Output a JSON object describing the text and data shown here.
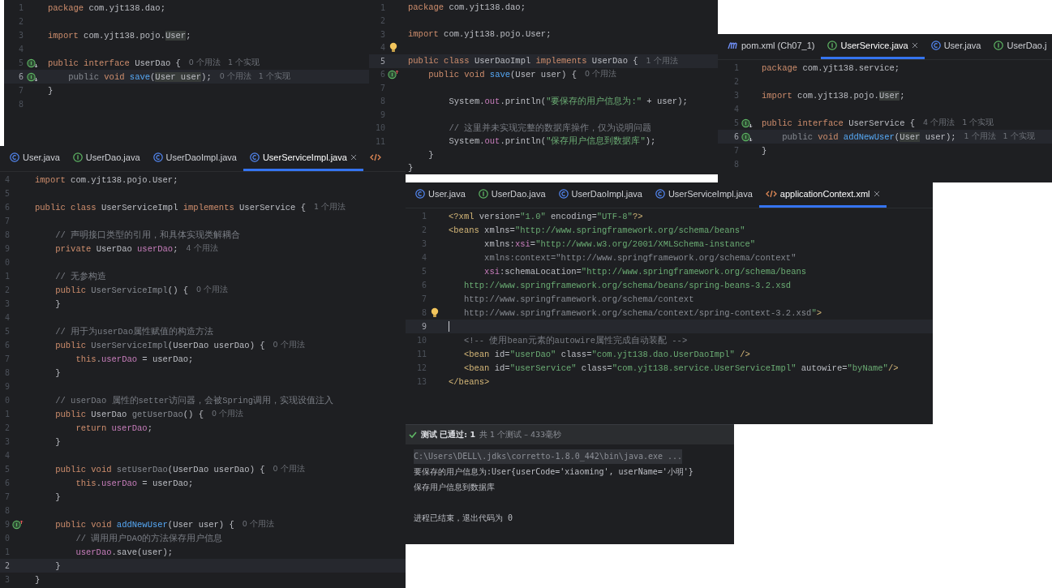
{
  "editors": [
    {
      "lines": [
        {
          "number": "1",
          "tokens": [
            {
              "kind": "kw",
              "text": "package "
            },
            {
              "kind": "plain",
              "text": "com.yjt138.dao;"
            }
          ]
        },
        {
          "number": "2"
        },
        {
          "number": "3",
          "tokens": [
            {
              "kind": "kw",
              "text": "import "
            },
            {
              "kind": "plain",
              "text": "com.yjt138.pojo."
            },
            {
              "kind": "hl",
              "text": "User"
            },
            {
              "kind": "plain",
              "text": ";"
            }
          ]
        },
        {
          "number": "4"
        },
        {
          "number": "5",
          "gutter": {
            "kind": "down"
          },
          "tokens": [
            {
              "kind": "kw",
              "text": "public interface "
            },
            {
              "kind": "plain",
              "text": "UserDao {"
            }
          ],
          "hint": "0 个用法   1 个实现"
        },
        {
          "number": "6",
          "gutter": {
            "kind": "down"
          },
          "current": true,
          "tokens": [
            {
              "kind": "dim",
              "text": "    public "
            },
            {
              "kind": "kw",
              "text": "void "
            },
            {
              "kind": "fn",
              "text": "save"
            },
            {
              "kind": "plain",
              "text": "("
            },
            {
              "kind": "hl",
              "text": "User user"
            },
            {
              "kind": "plain",
              "text": ");"
            }
          ],
          "hint": "0 个用法   1 个实现"
        },
        {
          "number": "7",
          "tokens": [
            {
              "kind": "plain",
              "text": "}"
            }
          ]
        },
        {
          "number": "8"
        }
      ]
    },
    {
      "lines": [
        {
          "number": "1",
          "tokens": [
            {
              "kind": "kw",
              "text": "package "
            },
            {
              "kind": "plain",
              "text": "com.yjt138.dao;"
            }
          ]
        },
        {
          "number": "2"
        },
        {
          "number": "3",
          "tokens": [
            {
              "kind": "kw",
              "text": "import "
            },
            {
              "kind": "plain",
              "text": "com.yjt138.pojo.User;"
            }
          ]
        },
        {
          "number": "4",
          "gutter": {
            "kind": "bulb"
          }
        },
        {
          "number": "5",
          "current": true,
          "tokens": [
            {
              "kind": "kw",
              "text": "public class "
            },
            {
              "kind": "plain",
              "text": "UserDaoImpl "
            },
            {
              "kind": "kw",
              "text": "implements "
            },
            {
              "kind": "plain",
              "text": "UserDao {"
            }
          ],
          "hint": "1 个用法"
        },
        {
          "number": "6",
          "gutter": {
            "kind": "up"
          },
          "tokens": [
            {
              "kind": "kw",
              "text": "    public void "
            },
            {
              "kind": "fn",
              "text": "save"
            },
            {
              "kind": "plain",
              "text": "(User user) {"
            }
          ],
          "hint": "0 个用法"
        },
        {
          "number": "7"
        },
        {
          "number": "8",
          "tokens": [
            {
              "kind": "plain",
              "text": "        System."
            },
            {
              "kind": "field",
              "text": "out"
            },
            {
              "kind": "plain",
              "text": ".println("
            },
            {
              "kind": "str",
              "text": "\"要保存的用户信息为:\""
            },
            {
              "kind": "plain",
              "text": " + user);"
            }
          ]
        },
        {
          "number": "9"
        },
        {
          "number": "10",
          "tokens": [
            {
              "kind": "cmt",
              "text": "        // 这里并未实现完整的数据库操作，仅为说明问题"
            }
          ]
        },
        {
          "number": "11",
          "tokens": [
            {
              "kind": "plain",
              "text": "        System."
            },
            {
              "kind": "field",
              "text": "out"
            },
            {
              "kind": "plain",
              "text": ".println("
            },
            {
              "kind": "str",
              "text": "\"保存用户信息到数据库\""
            },
            {
              "kind": "plain",
              "text": ");"
            }
          ]
        },
        {
          "tokens": [
            {
              "kind": "plain",
              "text": "    }"
            }
          ]
        },
        {
          "tokens": [
            {
              "kind": "plain",
              "text": "}"
            }
          ]
        }
      ]
    },
    {
      "tabs": [
        {
          "label": "pom.xml (Ch07_1)",
          "kind": "maven",
          "selected": false
        },
        {
          "label": "UserService.java",
          "kind": "interface",
          "selected": true
        },
        {
          "label": "User.java",
          "kind": "class",
          "selected": false
        },
        {
          "label": "UserDao.j",
          "kind": "interface",
          "selected": false
        }
      ],
      "lines": [
        {
          "number": "1",
          "tokens": [
            {
              "kind": "kw",
              "text": "package "
            },
            {
              "kind": "plain",
              "text": "com.yjt138.service;"
            }
          ]
        },
        {
          "number": "2"
        },
        {
          "number": "3",
          "tokens": [
            {
              "kind": "kw",
              "text": "import "
            },
            {
              "kind": "plain",
              "text": "com.yjt138.pojo."
            },
            {
              "kind": "hl",
              "text": "User"
            },
            {
              "kind": "plain",
              "text": ";"
            }
          ]
        },
        {
          "number": "4"
        },
        {
          "number": "5",
          "gutter": {
            "kind": "down"
          },
          "tokens": [
            {
              "kind": "kw",
              "text": "public interface "
            },
            {
              "kind": "plain",
              "text": "UserService {"
            }
          ],
          "hint": "4 个用法   1 个实现"
        },
        {
          "number": "6",
          "gutter": {
            "kind": "down"
          },
          "current": true,
          "tokens": [
            {
              "kind": "dim",
              "text": "    public "
            },
            {
              "kind": "kw",
              "text": "void "
            },
            {
              "kind": "fn",
              "text": "addNewUser"
            },
            {
              "kind": "plain",
              "text": "("
            },
            {
              "kind": "hl",
              "text": "User"
            },
            {
              "kind": "plain",
              "text": " user);"
            }
          ],
          "hint": "1 个用法   1 个实现"
        },
        {
          "number": "7",
          "tokens": [
            {
              "kind": "plain",
              "text": "}"
            }
          ]
        },
        {
          "number": "8"
        }
      ]
    },
    {
      "tabs": [
        {
          "label": "User.java",
          "kind": "class",
          "selected": false
        },
        {
          "label": "UserDao.java",
          "kind": "interface",
          "selected": false
        },
        {
          "label": "UserDaoImpl.java",
          "kind": "class",
          "selected": false
        },
        {
          "label": "UserServiceImpl.java",
          "kind": "class",
          "selected": true
        },
        {
          "kind": "xml",
          "selected": false
        }
      ],
      "lines": [
        {
          "number": "4",
          "tokens": [
            {
              "kind": "kw",
              "text": "import "
            },
            {
              "kind": "plain",
              "text": "com.yjt138.pojo.User;"
            }
          ]
        },
        {
          "number": "5"
        },
        {
          "number": "6",
          "tokens": [
            {
              "kind": "kw",
              "text": "public class "
            },
            {
              "kind": "plain",
              "text": "UserServiceImpl "
            },
            {
              "kind": "kw",
              "text": "implements "
            },
            {
              "kind": "plain",
              "text": "UserService {"
            }
          ],
          "hint": "1 个用法"
        },
        {
          "number": "7"
        },
        {
          "number": "8",
          "tokens": [
            {
              "kind": "cmt",
              "text": "    // 声明接口类型的引用，和具体实现类解耦合"
            }
          ]
        },
        {
          "number": "9",
          "tokens": [
            {
              "kind": "kw",
              "text": "    private "
            },
            {
              "kind": "plain",
              "text": "UserDao "
            },
            {
              "kind": "field",
              "text": "userDao"
            },
            {
              "kind": "plain",
              "text": ";"
            }
          ],
          "hint": "4 个用法"
        },
        {
          "number": "0"
        },
        {
          "number": "1",
          "tokens": [
            {
              "kind": "cmt",
              "text": "    // 无参构造"
            }
          ]
        },
        {
          "number": "2",
          "tokens": [
            {
              "kind": "kw",
              "text": "    public "
            },
            {
              "kind": "dim",
              "text": "UserServiceImpl"
            },
            {
              "kind": "plain",
              "text": "() {"
            }
          ],
          "hint": "0 个用法"
        },
        {
          "number": "3",
          "tokens": [
            {
              "kind": "plain",
              "text": "    }"
            }
          ]
        },
        {
          "number": "4"
        },
        {
          "number": "5",
          "tokens": [
            {
              "kind": "cmt",
              "text": "    // 用于为userDao属性赋值的构造方法"
            }
          ]
        },
        {
          "number": "6",
          "tokens": [
            {
              "kind": "kw",
              "text": "    public "
            },
            {
              "kind": "dim",
              "text": "UserServiceImpl"
            },
            {
              "kind": "plain",
              "text": "(UserDao userDao) {"
            }
          ],
          "hint": "0 个用法"
        },
        {
          "number": "7",
          "tokens": [
            {
              "kind": "kw",
              "text": "        this"
            },
            {
              "kind": "plain",
              "text": "."
            },
            {
              "kind": "field",
              "text": "userDao"
            },
            {
              "kind": "plain",
              "text": " = userDao;"
            }
          ]
        },
        {
          "number": "8",
          "tokens": [
            {
              "kind": "plain",
              "text": "    }"
            }
          ]
        },
        {
          "number": "9"
        },
        {
          "number": "0",
          "tokens": [
            {
              "kind": "cmt",
              "text": "    // userDao 属性的setter访问器，会被Spring调用，实现设值注入"
            }
          ]
        },
        {
          "number": "1",
          "tokens": [
            {
              "kind": "kw",
              "text": "    public "
            },
            {
              "kind": "plain",
              "text": "UserDao "
            },
            {
              "kind": "dim",
              "text": "getUserDao"
            },
            {
              "kind": "plain",
              "text": "() {"
            }
          ],
          "hint": "0 个用法"
        },
        {
          "number": "2",
          "tokens": [
            {
              "kind": "kw",
              "text": "        return "
            },
            {
              "kind": "field",
              "text": "userDao"
            },
            {
              "kind": "plain",
              "text": ";"
            }
          ]
        },
        {
          "number": "3",
          "tokens": [
            {
              "kind": "plain",
              "text": "    }"
            }
          ]
        },
        {
          "number": "4"
        },
        {
          "number": "5",
          "tokens": [
            {
              "kind": "kw",
              "text": "    public void "
            },
            {
              "kind": "dim",
              "text": "setUserDao"
            },
            {
              "kind": "plain",
              "text": "(UserDao userDao) {"
            }
          ],
          "hint": "0 个用法"
        },
        {
          "number": "6",
          "tokens": [
            {
              "kind": "kw",
              "text": "        this"
            },
            {
              "kind": "plain",
              "text": "."
            },
            {
              "kind": "field",
              "text": "userDao"
            },
            {
              "kind": "plain",
              "text": " = userDao;"
            }
          ]
        },
        {
          "number": "7",
          "tokens": [
            {
              "kind": "plain",
              "text": "    }"
            }
          ]
        },
        {
          "number": "8"
        },
        {
          "number": "9",
          "gutter": {
            "kind": "up"
          },
          "tokens": [
            {
              "kind": "kw",
              "text": "    public void "
            },
            {
              "kind": "fn",
              "text": "addNewUser"
            },
            {
              "kind": "plain",
              "text": "(User user) {"
            }
          ],
          "hint": "0 个用法"
        },
        {
          "number": "0",
          "tokens": [
            {
              "kind": "cmt",
              "text": "        // 调用用户DAO的方法保存用户信息"
            }
          ]
        },
        {
          "number": "1",
          "tokens": [
            {
              "kind": "field",
              "text": "        userDao"
            },
            {
              "kind": "plain",
              "text": ".save(user);"
            }
          ]
        },
        {
          "number": "2",
          "current": true,
          "tokens": [
            {
              "kind": "plain",
              "text": "    }"
            }
          ]
        },
        {
          "number": "3",
          "tokens": [
            {
              "kind": "plain",
              "text": "}"
            }
          ]
        }
      ]
    },
    {
      "tabs": [
        {
          "label": "User.java",
          "kind": "class",
          "selected": false
        },
        {
          "label": "UserDao.java",
          "kind": "interface",
          "selected": false
        },
        {
          "label": "UserDaoImpl.java",
          "kind": "class",
          "selected": false
        },
        {
          "label": "UserServiceImpl.java",
          "kind": "class",
          "selected": false
        },
        {
          "label": "applicationContext.xml",
          "kind": "xml",
          "selected": true
        }
      ],
      "lines": [
        {
          "number": "1",
          "tokens": [
            {
              "kind": "tag",
              "text": "<?xml "
            },
            {
              "kind": "plain",
              "text": "version="
            },
            {
              "kind": "str",
              "text": "\"1.0\" "
            },
            {
              "kind": "plain",
              "text": "encoding="
            },
            {
              "kind": "str",
              "text": "\"UTF-8\""
            },
            {
              "kind": "tag",
              "text": "?>"
            }
          ]
        },
        {
          "number": "2",
          "tokens": [
            {
              "kind": "tag",
              "text": "<beans "
            },
            {
              "kind": "plain",
              "text": "xmlns="
            },
            {
              "kind": "str",
              "text": "\"http://www.springframework.org/schema/beans\""
            }
          ]
        },
        {
          "number": "3",
          "tokens": [
            {
              "kind": "plain",
              "text": "       xmlns:"
            },
            {
              "kind": "field",
              "text": "xsi"
            },
            {
              "kind": "plain",
              "text": "="
            },
            {
              "kind": "str",
              "text": "\"http://www.w3.org/2001/XMLSchema-instance\""
            }
          ]
        },
        {
          "number": "4",
          "tokens": [
            {
              "kind": "dim",
              "text": "       xmlns:context=\"http://www.springframework.org/schema/context\""
            }
          ]
        },
        {
          "number": "5",
          "tokens": [
            {
              "kind": "field",
              "text": "       xsi"
            },
            {
              "kind": "plain",
              "text": ":schemaLocation="
            },
            {
              "kind": "str",
              "text": "\"http://www.springframework.org/schema/beans"
            }
          ]
        },
        {
          "number": "6",
          "tokens": [
            {
              "kind": "str",
              "text": "   http://www.springframework.org/schema/beans/spring-beans-3.2.xsd"
            }
          ]
        },
        {
          "number": "7",
          "tokens": [
            {
              "kind": "dim",
              "text": "   http://www.springframework.org/schema/context"
            }
          ]
        },
        {
          "number": "8",
          "gutter": {
            "kind": "bulb"
          },
          "tokens": [
            {
              "kind": "dim",
              "text": "   http://www.springframework.org/schema/context/spring-context-3.2.xsd"
            },
            {
              "kind": "str",
              "text": "\""
            },
            {
              "kind": "tag",
              "text": ">"
            }
          ]
        },
        {
          "number": "9",
          "current": true
        },
        {
          "number": "10",
          "tokens": [
            {
              "kind": "cmt",
              "text": "   <!-- 使用bean元素的autowire属性完成自动装配 -->"
            }
          ]
        },
        {
          "number": "11",
          "tokens": [
            {
              "kind": "tag",
              "text": "   <bean "
            },
            {
              "kind": "plain",
              "text": "id="
            },
            {
              "kind": "str",
              "text": "\"userDao\" "
            },
            {
              "kind": "plain",
              "text": "class="
            },
            {
              "kind": "str",
              "text": "\"com.yjt138.dao.UserDaoImpl\" "
            },
            {
              "kind": "tag",
              "text": "/>"
            }
          ]
        },
        {
          "number": "12",
          "tokens": [
            {
              "kind": "tag",
              "text": "   <bean "
            },
            {
              "kind": "plain",
              "text": "id="
            },
            {
              "kind": "str",
              "text": "\"userService\" "
            },
            {
              "kind": "plain",
              "text": "class="
            },
            {
              "kind": "str",
              "text": "\"com.yjt138.service.UserServiceImpl\" "
            },
            {
              "kind": "plain",
              "text": "autowire="
            },
            {
              "kind": "str",
              "text": "\"byName\""
            },
            {
              "kind": "tag",
              "text": "/>"
            }
          ]
        },
        {
          "number": "13",
          "tokens": [
            {
              "kind": "tag",
              "text": "</beans>"
            }
          ]
        }
      ]
    }
  ],
  "run_console": {
    "status": "测试 已通过: 1",
    "summary": "共 1 个测试 – 433毫秒",
    "passed": true,
    "command": "C:\\Users\\DELL\\.jdks\\corretto-1.8.0_442\\bin\\java.exe ...",
    "output": [
      "要保存的用户信息为:User{userCode='xiaoming', userName='小明'}",
      "保存用户信息到数据库"
    ],
    "exit_message": "进程已结束，退出代码为 0"
  }
}
